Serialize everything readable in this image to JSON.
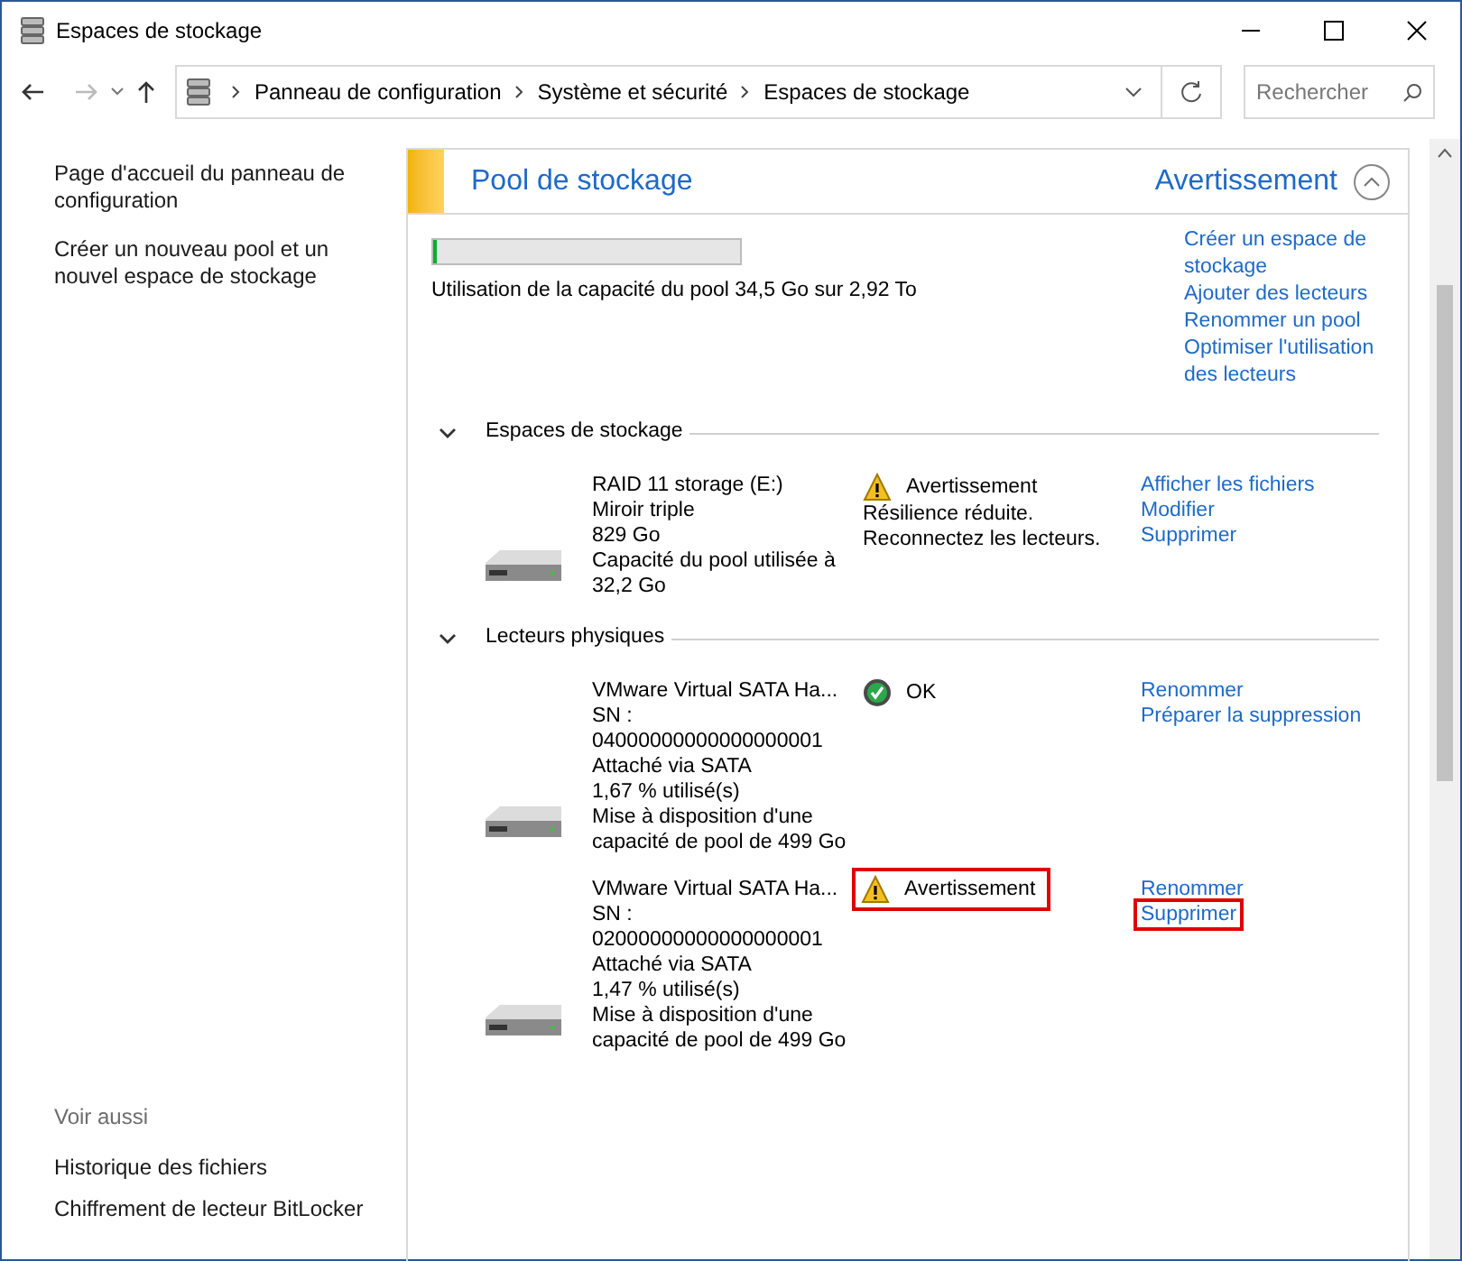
{
  "window": {
    "title": "Espaces de stockage"
  },
  "address_bar": {
    "breadcrumbs": [
      "Panneau de configuration",
      "Système et sécurité",
      "Espaces de stockage"
    ]
  },
  "search": {
    "placeholder": "Rechercher"
  },
  "sidebar": {
    "links": [
      "Page d'accueil du panneau de configuration",
      "Créer un nouveau pool et un nouvel espace de stockage"
    ],
    "see_also_title": "Voir aussi",
    "see_also": [
      "Historique des fichiers",
      "Chiffrement de lecteur BitLocker"
    ]
  },
  "pool": {
    "title": "Pool de stockage",
    "status": "Avertissement",
    "expanded": true,
    "level": 0.012,
    "usage": "Utilisation de la capacité du pool 34,5 Go sur 2,92 To",
    "actions": [
      "Créer un espace de stockage",
      "Ajouter des lecteurs",
      "Renommer un pool",
      "Optimiser l'utilisation des lecteurs"
    ]
  },
  "sections": [
    {
      "title": "Espaces de stockage",
      "expanded": true,
      "items": [
        {
          "details": [
            "RAID 11 storage (E:)",
            "Miroir triple",
            "829 Go",
            "Capacité du pool utilisée à 32,2 Go"
          ],
          "status": {
            "kind": "warning",
            "label": "Avertissement",
            "highlighted": false
          },
          "messages": [
            "Résilience réduite.",
            "Reconnectez les lecteurs."
          ],
          "actions": [
            {
              "label": "Afficher les fichiers",
              "highlighted": false
            },
            {
              "label": "Modifier",
              "highlighted": false
            },
            {
              "label": "Supprimer",
              "highlighted": false
            }
          ]
        }
      ]
    },
    {
      "title": "Lecteurs physiques",
      "expanded": true,
      "items": [
        {
          "details": [
            "VMware Virtual SATA Ha...",
            "SN :",
            "04000000000000000001",
            "Attaché via SATA",
            "1,67 % utilisé(s)",
            "Mise à disposition d'une capacité de pool de 499 Go"
          ],
          "status": {
            "kind": "ok",
            "label": "OK",
            "highlighted": false
          },
          "actions": [
            {
              "label": "Renommer",
              "highlighted": false
            },
            {
              "label": "Préparer la suppression",
              "highlighted": false
            }
          ]
        },
        {
          "details": [
            "VMware Virtual SATA Ha...",
            "SN :",
            "02000000000000000001",
            "Attaché via SATA",
            "1,47 % utilisé(s)",
            "Mise à disposition d'une capacité de pool de 499 Go"
          ],
          "status": {
            "kind": "warning",
            "label": "Avertissement",
            "highlighted": true
          },
          "actions": [
            {
              "label": "Renommer",
              "highlighted": false
            },
            {
              "label": "Supprimer",
              "highlighted": true
            }
          ]
        }
      ]
    }
  ]
}
